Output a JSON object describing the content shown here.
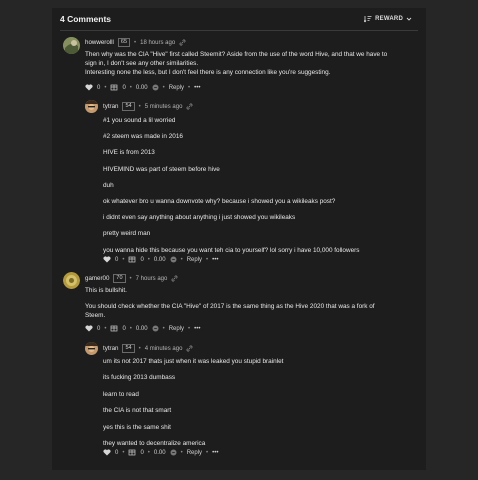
{
  "header": {
    "title": "4 Comments",
    "sort_label": "REWARD"
  },
  "comments": [
    {
      "author": "howwerolll",
      "rep": "65",
      "time": "18 hours ago",
      "lines": [
        "Then why was the CIA \"Hive\" first called Steemit? Aside from the use of the word Hive, and that we have to",
        "sign in, I don't see any other similarities.",
        "Interesting none the less, but I don't feel there is any connection like you're suggesting."
      ],
      "votes": "0",
      "repost": "0",
      "payout": "0.00",
      "reply": "Reply",
      "more": "•••"
    },
    {
      "author": "tytran",
      "rep": "54",
      "time": "5 minutes ago",
      "lines": [
        "#1 you sound a lil worried",
        "#2 steem was made in 2016",
        "HIVE is from 2013",
        "HIVEMIND was part of steem before hive",
        "duh",
        "ok whatever bro u wanna downvote why? because i showed you a wikileaks post?",
        "i didnt even say anything about anything i just showed you wikileaks",
        "pretty weird man",
        "you wanna hide this because you want teh cia to yourself? lol sorry i have 10,000 followers"
      ],
      "votes": "0",
      "repost": "0",
      "payout": "0.00",
      "reply": "Reply",
      "more": "•••"
    },
    {
      "author": "gamer00",
      "rep": "70",
      "time": "7 hours ago",
      "lines": [
        "This is bullshit.",
        "You should check whether the CIA \"Hive\" of 2017 is the same thing as the Hive 2020 that was a fork of",
        "Steem."
      ],
      "votes": "0",
      "repost": "0",
      "payout": "0.00",
      "reply": "Reply",
      "more": "•••"
    },
    {
      "author": "tytran",
      "rep": "54",
      "time": "4 minutes ago",
      "lines": [
        "um its not 2017 thats just when it was leaked you stupid brainlet",
        "its fucking 2013 dumbass",
        "learn to read",
        "the CIA is not that smart",
        "yes this is the same shit",
        "they wanted to decentralize america"
      ],
      "votes": "0",
      "repost": "0",
      "payout": "0.00",
      "reply": "Reply",
      "more": "•••"
    }
  ],
  "colors": {
    "background": "#262626",
    "card": "#1d1d1d",
    "text": "#e9e9e9",
    "muted": "#b5b5b5"
  }
}
